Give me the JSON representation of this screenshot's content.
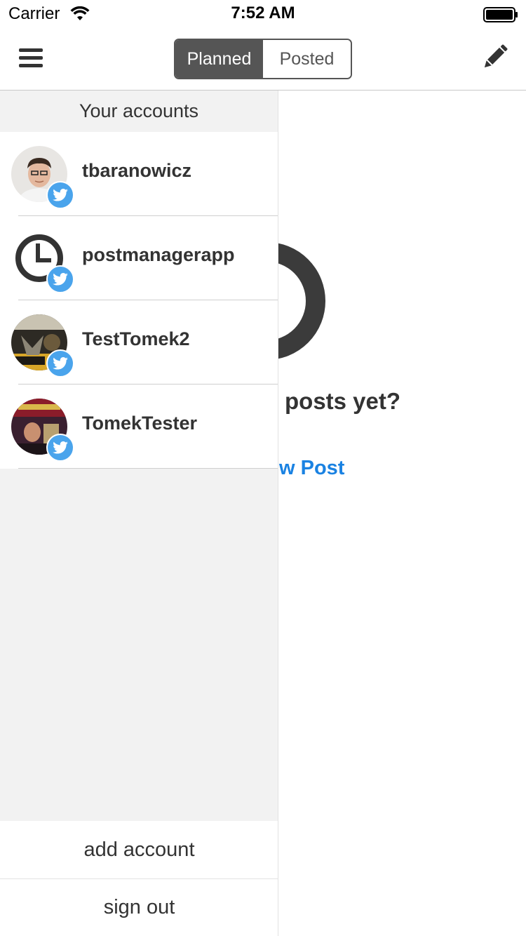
{
  "status_bar": {
    "carrier": "Carrier",
    "time": "7:52 AM"
  },
  "nav": {
    "menu_icon": "hamburger-icon",
    "segments": [
      {
        "label": "Planned",
        "selected": true
      },
      {
        "label": "Posted",
        "selected": false
      }
    ],
    "edit_icon": "pencil-icon"
  },
  "background": {
    "empty_text": "posts yet?",
    "link_text": "w Post",
    "link_color": "#1a82e2"
  },
  "drawer": {
    "header": "Your accounts",
    "accounts": [
      {
        "name": "tbaranowicz",
        "network": "twitter",
        "selected": true
      },
      {
        "name": "postmanagerapp",
        "network": "twitter",
        "selected": false
      },
      {
        "name": "TestTomek2",
        "network": "twitter",
        "selected": false
      },
      {
        "name": "TomekTester",
        "network": "twitter",
        "selected": false
      }
    ],
    "add_account": "add account",
    "sign_out": "sign out"
  },
  "colors": {
    "twitter_blue": "#4aa4ec",
    "segment_active": "#555555",
    "drawer_bg": "#f2f2f2"
  }
}
